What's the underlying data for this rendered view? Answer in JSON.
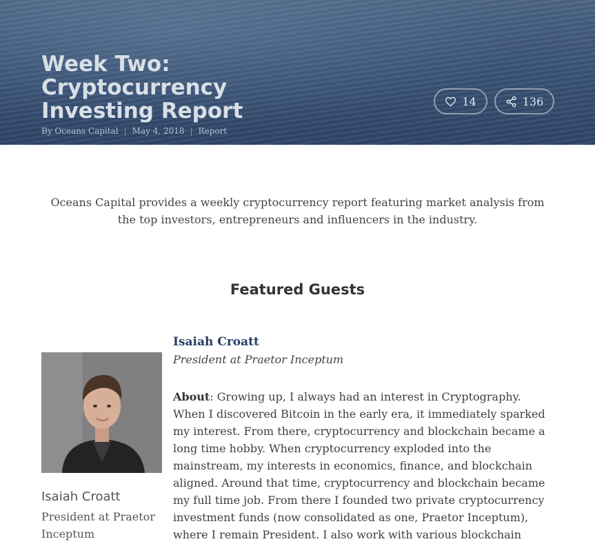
{
  "hero": {
    "title": "Week Two: Cryptocurrency Investing Report",
    "byline": "By Oceans Capital",
    "date": "May 4, 2018",
    "category": "Report",
    "likes": "14",
    "shares": "136"
  },
  "intro": "Oceans Capital provides a weekly cryptocurrency report featuring market analysis from the top investors, entrepreneurs and influencers in the industry.",
  "featured": {
    "heading": "Featured Guests",
    "guest": {
      "caption_name": "Isaiah Croatt",
      "caption_role": "President at Praetor Inceptum",
      "name": "Isaiah Croatt",
      "role": "President at Praetor Inceptum",
      "about_label": "About",
      "about": ": Growing up, I always had an interest in Cryptography. When I discovered Bitcoin in the early era, it immediately sparked my interest. From there, cryptocurrency and blockchain became a long time hobby. When cryptocurrency exploded into the mainstream, my interests in economics, finance, and blockchain aligned. Around that time, cryptocurrency and blockchain became my full time job. From there I founded two private cryptocurrency investment funds (now consolidated as one, Praetor Inceptum), where I remain President. I also work with various blockchain"
    }
  }
}
